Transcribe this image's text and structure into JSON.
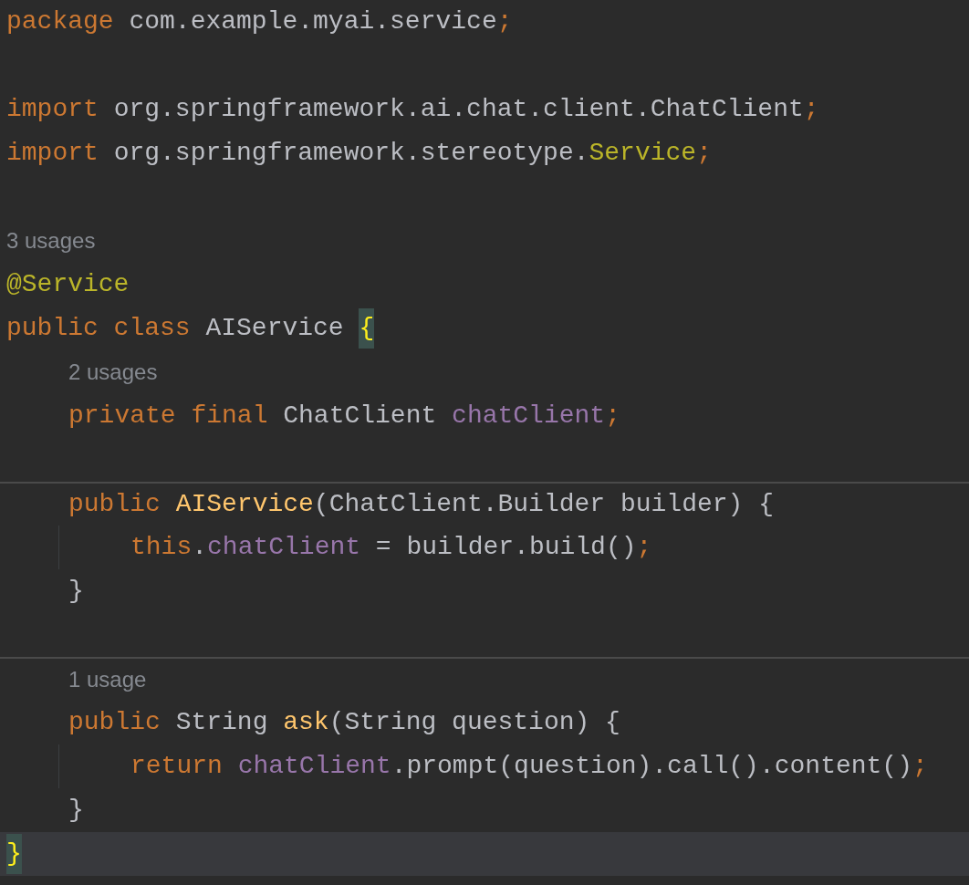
{
  "editor": {
    "lines": [
      {
        "kind": "code",
        "current": false,
        "separator": false,
        "tokens": [
          {
            "text": "package ",
            "kind": "keyword"
          },
          {
            "text": "com.example.myai.service",
            "kind": "plain"
          },
          {
            "text": ";",
            "kind": "punct"
          }
        ]
      },
      {
        "kind": "blank"
      },
      {
        "kind": "code",
        "current": false,
        "separator": false,
        "tokens": [
          {
            "text": "import ",
            "kind": "keyword"
          },
          {
            "text": "org.springframework.ai.chat.client.ChatClient",
            "kind": "plain"
          },
          {
            "text": ";",
            "kind": "punct"
          }
        ]
      },
      {
        "kind": "code",
        "current": false,
        "separator": false,
        "tokens": [
          {
            "text": "import ",
            "kind": "keyword"
          },
          {
            "text": "org.springframework.stereotype.",
            "kind": "plain"
          },
          {
            "text": "Service",
            "kind": "annotation"
          },
          {
            "text": ";",
            "kind": "punct"
          }
        ]
      },
      {
        "kind": "blank"
      },
      {
        "kind": "usages",
        "current": false,
        "separator": false,
        "text": "3 usages"
      },
      {
        "kind": "code",
        "current": false,
        "separator": false,
        "tokens": [
          {
            "text": "@Service",
            "kind": "annotation"
          }
        ]
      },
      {
        "kind": "code",
        "current": false,
        "separator": false,
        "tokens": [
          {
            "text": "public class ",
            "kind": "keyword"
          },
          {
            "text": "AIService ",
            "kind": "plain"
          },
          {
            "text": "{",
            "kind": "brace-match"
          }
        ],
        "children": [
          {
            "kind": "usages",
            "current": false,
            "separator": false,
            "text": "2 usages"
          },
          {
            "kind": "code",
            "current": false,
            "separator": false,
            "tokens": [
              {
                "text": "private final ",
                "kind": "keyword"
              },
              {
                "text": "ChatClient ",
                "kind": "plain"
              },
              {
                "text": "chatClient",
                "kind": "field"
              },
              {
                "text": ";",
                "kind": "punct"
              }
            ]
          },
          {
            "kind": "blank"
          },
          {
            "kind": "code",
            "current": false,
            "separator": true,
            "tokens": [
              {
                "text": "public ",
                "kind": "keyword"
              },
              {
                "text": "AIService",
                "kind": "method"
              },
              {
                "text": "(ChatClient.Builder builder) {",
                "kind": "plain"
              }
            ],
            "children": [
              {
                "kind": "code",
                "current": false,
                "separator": false,
                "tokens": [
                  {
                    "text": "this",
                    "kind": "keyword"
                  },
                  {
                    "text": ".",
                    "kind": "plain"
                  },
                  {
                    "text": "chatClient",
                    "kind": "field"
                  },
                  {
                    "text": " = builder.build()",
                    "kind": "plain"
                  },
                  {
                    "text": ";",
                    "kind": "punct"
                  }
                ]
              }
            ]
          },
          {
            "kind": "code",
            "current": false,
            "separator": false,
            "tokens": [
              {
                "text": "}",
                "kind": "plain"
              }
            ]
          },
          {
            "kind": "blank"
          },
          {
            "kind": "usages",
            "current": false,
            "separator": true,
            "text": "1 usage"
          },
          {
            "kind": "code",
            "current": false,
            "separator": false,
            "tokens": [
              {
                "text": "public ",
                "kind": "keyword"
              },
              {
                "text": "String ",
                "kind": "plain"
              },
              {
                "text": "ask",
                "kind": "method"
              },
              {
                "text": "(String question) {",
                "kind": "plain"
              }
            ],
            "children": [
              {
                "kind": "code",
                "current": false,
                "separator": false,
                "tokens": [
                  {
                    "text": "return ",
                    "kind": "keyword"
                  },
                  {
                    "text": "chatClient",
                    "kind": "field"
                  },
                  {
                    "text": ".prompt(question).call().content()",
                    "kind": "plain"
                  },
                  {
                    "text": ";",
                    "kind": "punct"
                  }
                ]
              }
            ]
          },
          {
            "kind": "code",
            "current": false,
            "separator": false,
            "tokens": [
              {
                "text": "}",
                "kind": "plain"
              }
            ]
          }
        ]
      },
      {
        "kind": "code",
        "current": true,
        "separator": false,
        "tokens": [
          {
            "text": "}",
            "kind": "brace-match"
          }
        ]
      }
    ]
  }
}
